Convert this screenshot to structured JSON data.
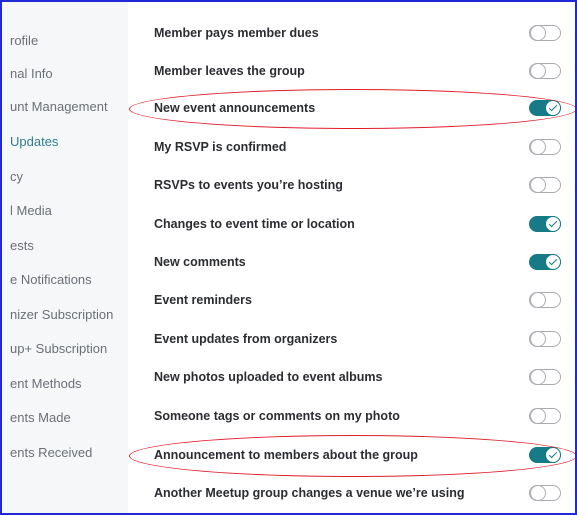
{
  "sidebar": {
    "items": [
      {
        "label": "rofile",
        "active": false
      },
      {
        "label": "nal Info",
        "active": false
      },
      {
        "label": "unt Management",
        "active": false
      },
      {
        "label": "Updates",
        "active": true
      },
      {
        "label": "cy",
        "active": false
      },
      {
        "label": "l Media",
        "active": false
      },
      {
        "label": "ests",
        "active": false
      },
      {
        "label": "e Notifications",
        "active": false
      },
      {
        "label": "nizer Subscription",
        "active": false
      },
      {
        "label": "up+ Subscription",
        "active": false
      },
      {
        "label": "ent Methods",
        "active": false
      },
      {
        "label": "ents Made",
        "active": false
      },
      {
        "label": "ents Received",
        "active": false
      }
    ]
  },
  "settings": [
    {
      "label": "Member pays member dues",
      "on": false
    },
    {
      "label": "Member leaves the group",
      "on": false
    },
    {
      "label": "New event announcements",
      "on": true
    },
    {
      "label": "My RSVP is confirmed",
      "on": false
    },
    {
      "label": "RSVPs to events you’re hosting",
      "on": false
    },
    {
      "label": "Changes to event time or location",
      "on": true
    },
    {
      "label": "New comments",
      "on": true
    },
    {
      "label": "Event reminders",
      "on": false
    },
    {
      "label": "Event updates from organizers",
      "on": false
    },
    {
      "label": "New photos uploaded to event albums",
      "on": false
    },
    {
      "label": "Someone tags or comments on my photo",
      "on": false
    },
    {
      "label": "Announcement to members about the group",
      "on": true
    },
    {
      "label": "Another Meetup group changes a venue we’re using",
      "on": false
    }
  ],
  "colors": {
    "accent": "#167b86",
    "frame_border": "#1f2ad4",
    "annotation_circle": "#e11d2a",
    "sidebar_bg": "#f6f7f8"
  }
}
